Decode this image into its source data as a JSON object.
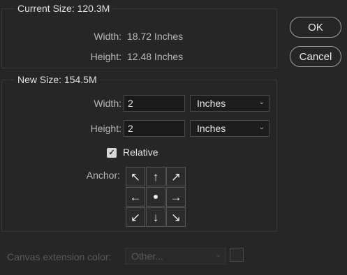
{
  "current_size": {
    "legend": "Current Size: 120.3M",
    "width_label": "Width:",
    "width_value": "18.72 Inches",
    "height_label": "Height:",
    "height_value": "12.48 Inches"
  },
  "new_size": {
    "legend": "New Size: 154.5M",
    "width_label": "Width:",
    "width_value": "2",
    "width_unit": "Inches",
    "height_label": "Height:",
    "height_value": "2",
    "height_unit": "Inches",
    "relative_label": "Relative",
    "relative_checked": true,
    "anchor_label": "Anchor:",
    "anchor_cells": [
      "↖",
      "↑",
      "↗",
      "←",
      "•",
      "→",
      "↙",
      "↓",
      "↘"
    ]
  },
  "buttons": {
    "ok": "OK",
    "cancel": "Cancel"
  },
  "extension": {
    "label": "Canvas extension color:",
    "value": "Other..."
  },
  "icons": {
    "checkbox": "checkmark-icon",
    "dropdown": "chevron-down-icon"
  }
}
